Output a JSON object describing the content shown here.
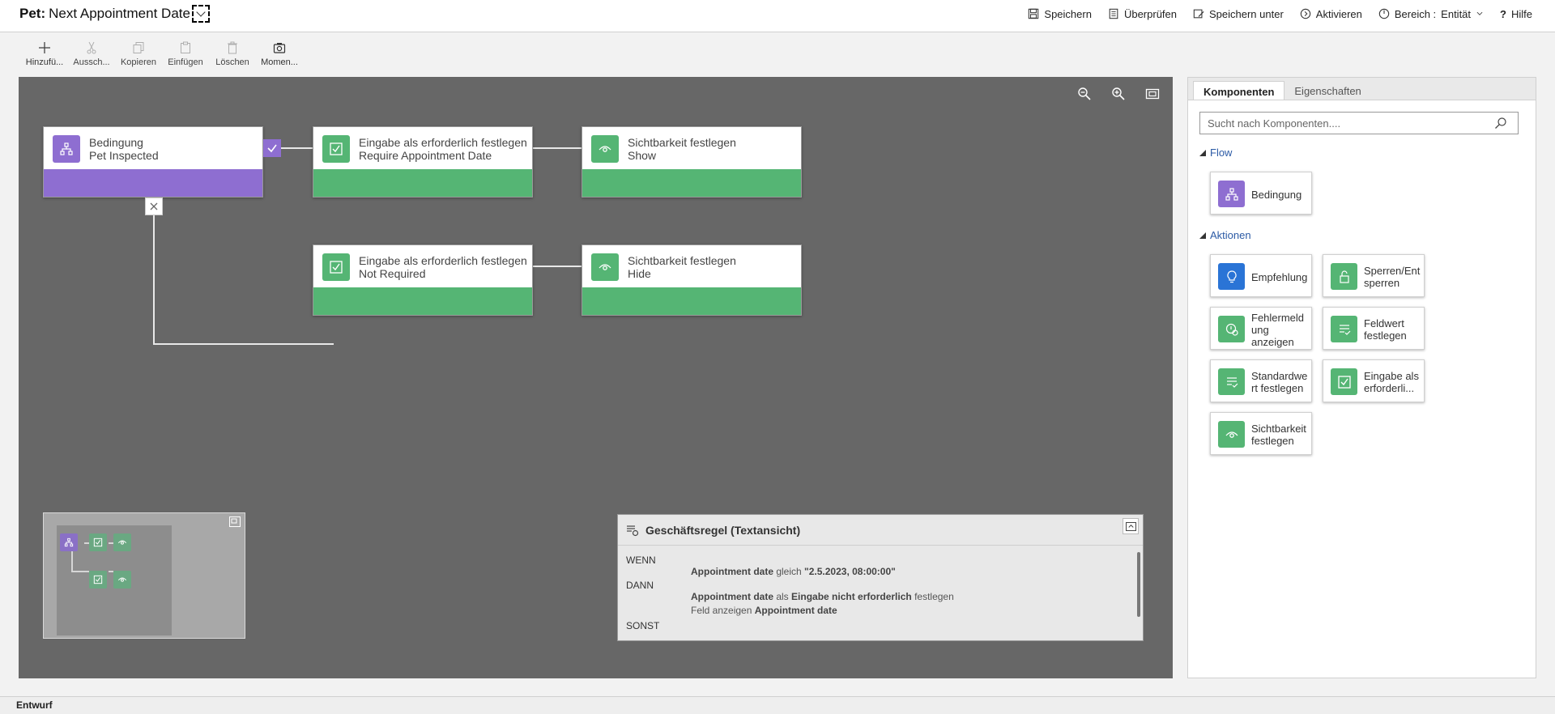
{
  "header": {
    "title_prefix": "Pet:",
    "title": "Next Appointment Date",
    "actions": {
      "save": "Speichern",
      "validate": "Überprüfen",
      "save_as": "Speichern unter",
      "activate": "Aktivieren",
      "scope_label": "Bereich :",
      "scope_value": "Entität",
      "help": "Hilfe"
    }
  },
  "toolbar": {
    "add": "Hinzufü...",
    "cut": "Aussch...",
    "copy": "Kopieren",
    "paste": "Einfügen",
    "delete": "Löschen",
    "snapshot": "Momen..."
  },
  "canvas": {
    "condition": {
      "title": "Bedingung",
      "subtitle": "Pet Inspected"
    },
    "node_required": {
      "title": "Eingabe als erforderlich festlegen",
      "subtitle": "Require Appointment Date"
    },
    "node_show": {
      "title": "Sichtbarkeit festlegen",
      "subtitle": "Show"
    },
    "node_not_required": {
      "title": "Eingabe als erforderlich festlegen",
      "subtitle": "Not Required"
    },
    "node_hide": {
      "title": "Sichtbarkeit festlegen",
      "subtitle": "Hide"
    }
  },
  "textview": {
    "title": "Geschäftsregel (Textansicht)",
    "if_kw": "WENN",
    "if_field": "Appointment date",
    "if_op": "gleich",
    "if_value": "\"2.5.2023, 08:00:00\"",
    "then_kw": "DANN",
    "then1_field": "Appointment date",
    "then1_mid": "als",
    "then1_value": "Eingabe nicht erforderlich",
    "then1_end": "festlegen",
    "then2_pre": "Feld anzeigen",
    "then2_field": "Appointment date",
    "else_kw": "SONST"
  },
  "panel": {
    "tabs": [
      "Komponenten",
      "Eigenschaften"
    ],
    "search_placeholder": "Sucht nach Komponenten....",
    "section_flow": "Flow",
    "section_actions": "Aktionen",
    "flow_items": [
      "Bedingung"
    ],
    "action_items": [
      "Empfehlung",
      "Sperren/Entsperren",
      "Fehlermeldung anzeigen",
      "Feldwert festlegen",
      "Standardwert festlegen",
      "Eingabe als erforderli...",
      "Sichtbarkeit festlegen"
    ]
  },
  "status": {
    "label": "Entwurf"
  },
  "colors": {
    "condition": "#8e6ed1",
    "action": "#55b574",
    "recommendation": "#2a74d6",
    "canvas": "#676767",
    "link": "#2b5aa5"
  }
}
